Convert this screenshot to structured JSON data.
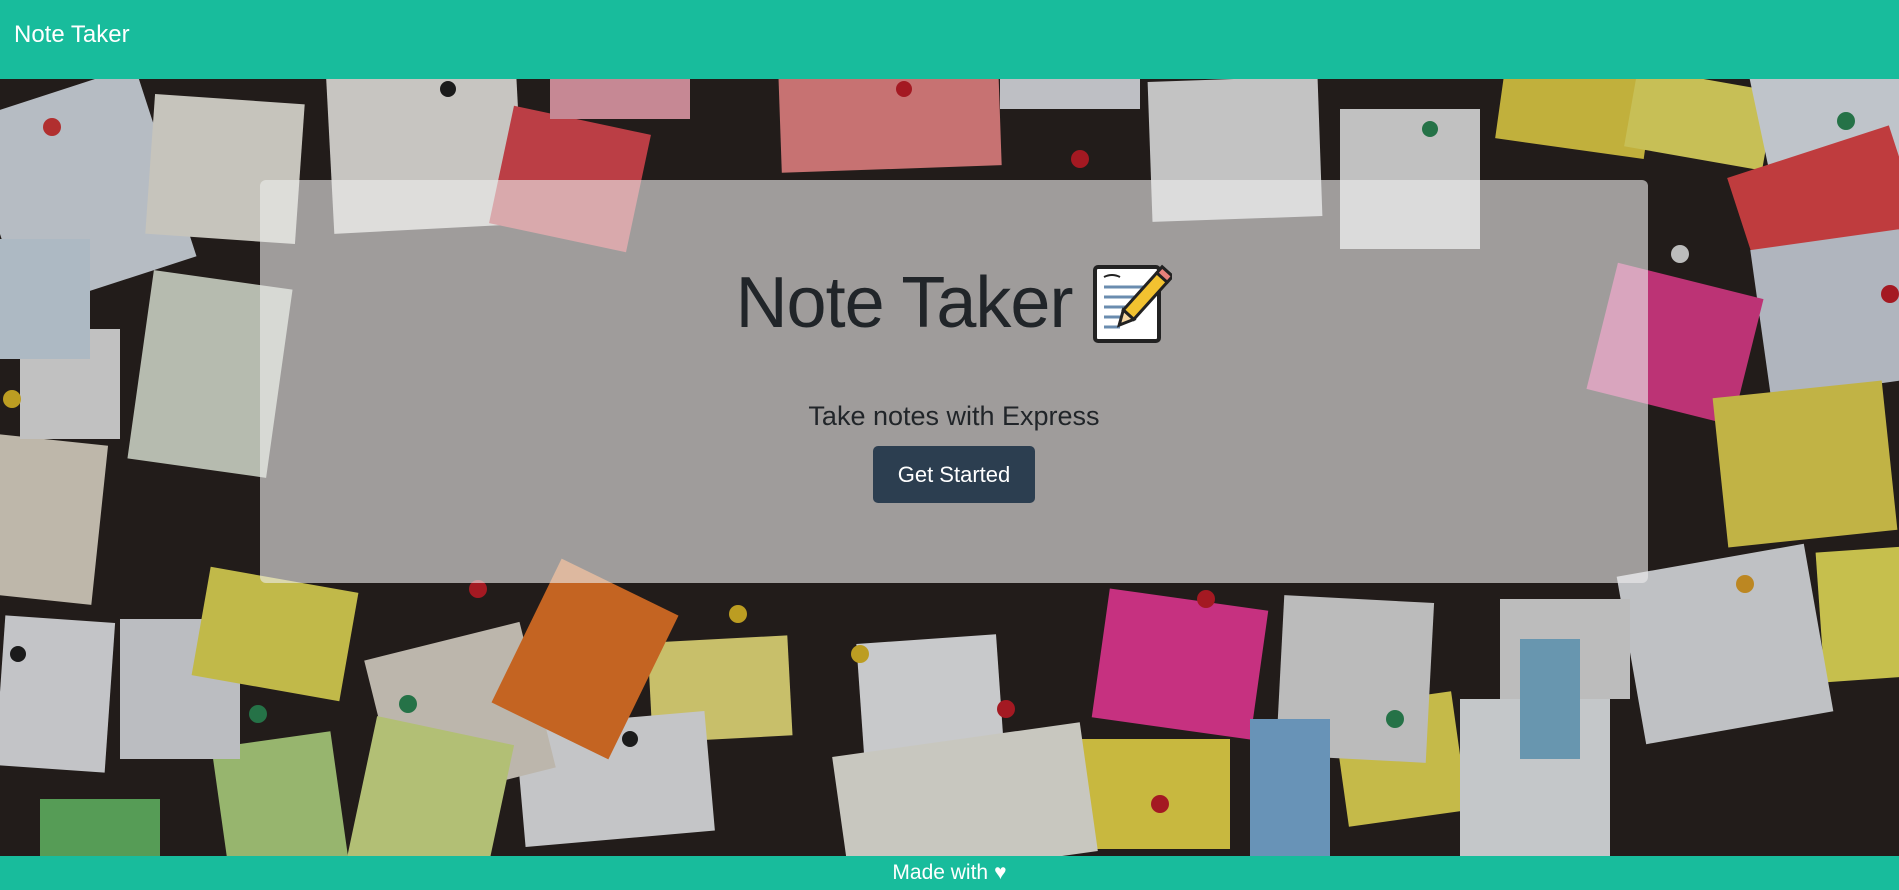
{
  "navbar": {
    "brand": "Note Taker"
  },
  "hero": {
    "title": "Note Taker",
    "subtitle": "Take notes with Express",
    "button_label": "Get Started",
    "icon": "memo-icon"
  },
  "footer": {
    "text": "Made with",
    "heart_glyph": "♥",
    "heart_icon": "heart-icon"
  },
  "colors": {
    "brand_teal": "#18bc9c",
    "button_navy": "#2c3e50",
    "text_dark": "#212529"
  },
  "background": {
    "description_icon": "sticky-notes-wall-image"
  }
}
